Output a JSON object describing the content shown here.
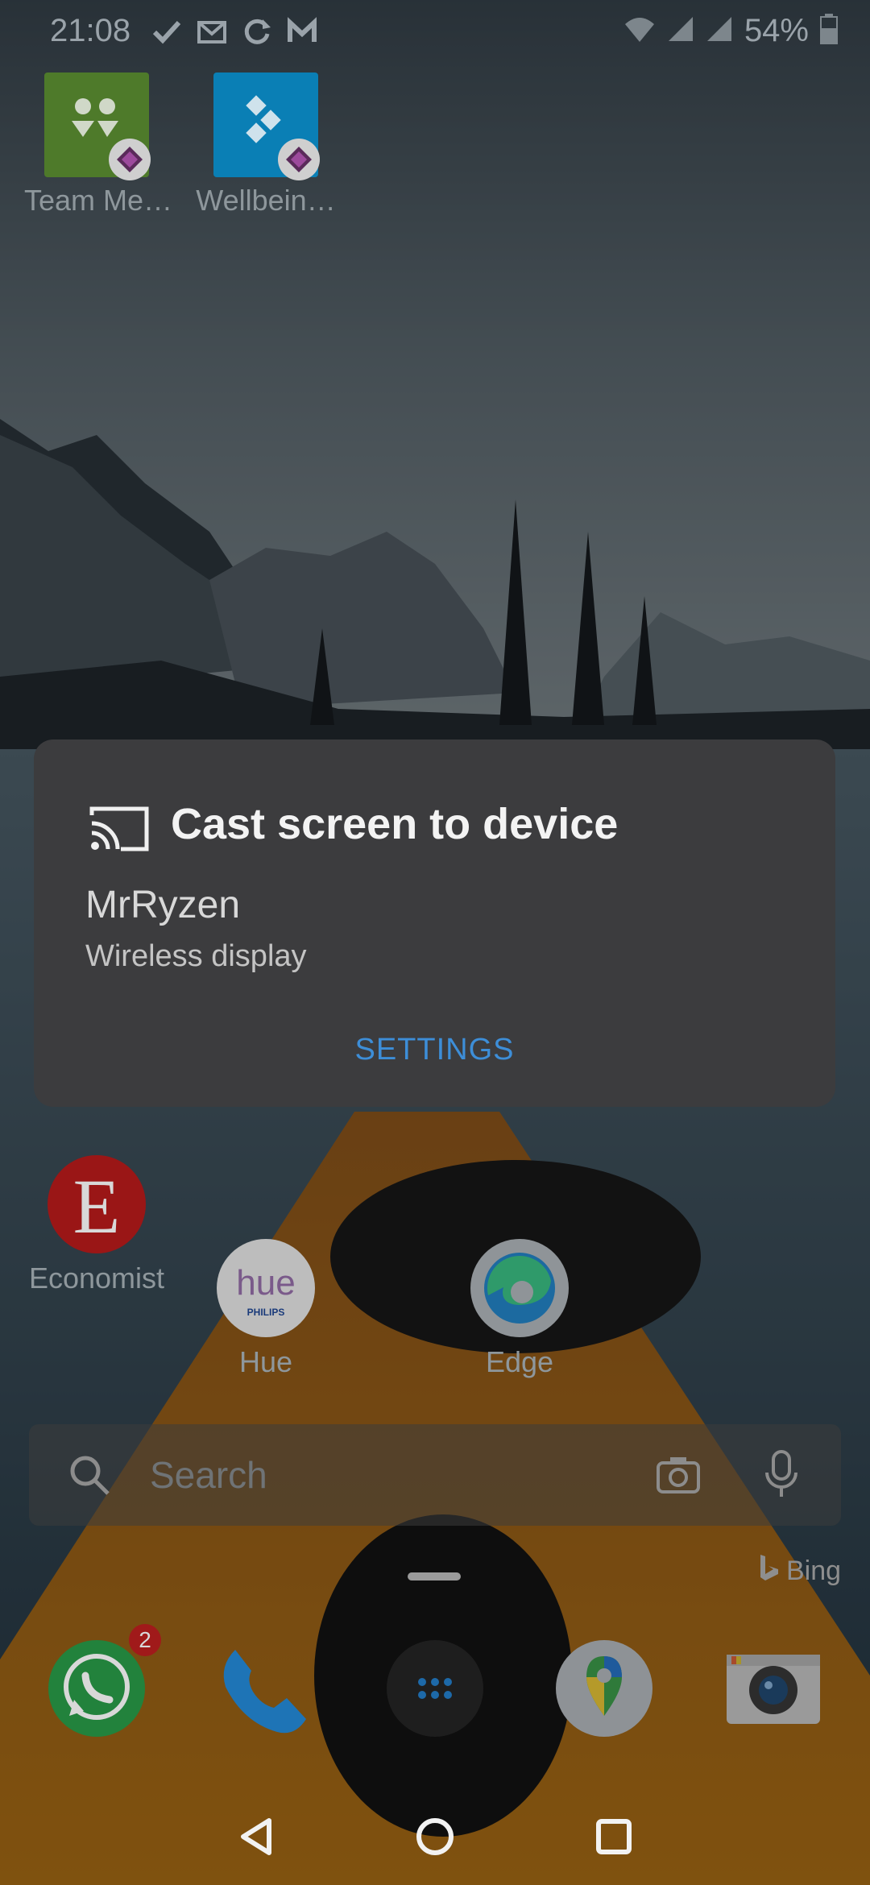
{
  "status_bar": {
    "time": "21:08",
    "battery": "54%"
  },
  "apps_top": [
    {
      "label": "Team Me…",
      "color": "#4e7a2a",
      "icon": "team-members-icon"
    },
    {
      "label": "Wellbein…",
      "color": "#0a7fb5",
      "icon": "wellbeing-icon"
    }
  ],
  "dialog": {
    "title": "Cast screen to device",
    "device_name": "MrRyzen",
    "device_type": "Wireless display",
    "settings_label": "SETTINGS"
  },
  "apps_middle": [
    {
      "label": "Economist",
      "icon": "economist-icon"
    },
    {
      "label": "Hue",
      "icon": "hue-icon"
    },
    {
      "label": "Edge",
      "icon": "edge-icon"
    }
  ],
  "hue_logo": {
    "word": "hue",
    "brand": "PHILIPS"
  },
  "economist_logo": "E",
  "search": {
    "placeholder": "Search",
    "provider": "Bing"
  },
  "dock": {
    "whatsapp_badge": "2",
    "apps": [
      "whatsapp-icon",
      "phone-icon",
      "app-drawer-icon",
      "maps-icon",
      "camera-icon"
    ]
  },
  "colors": {
    "accent": "#3d8ed8",
    "dialog_bg": "#3c3c3e",
    "badge": "#a01a1a"
  }
}
